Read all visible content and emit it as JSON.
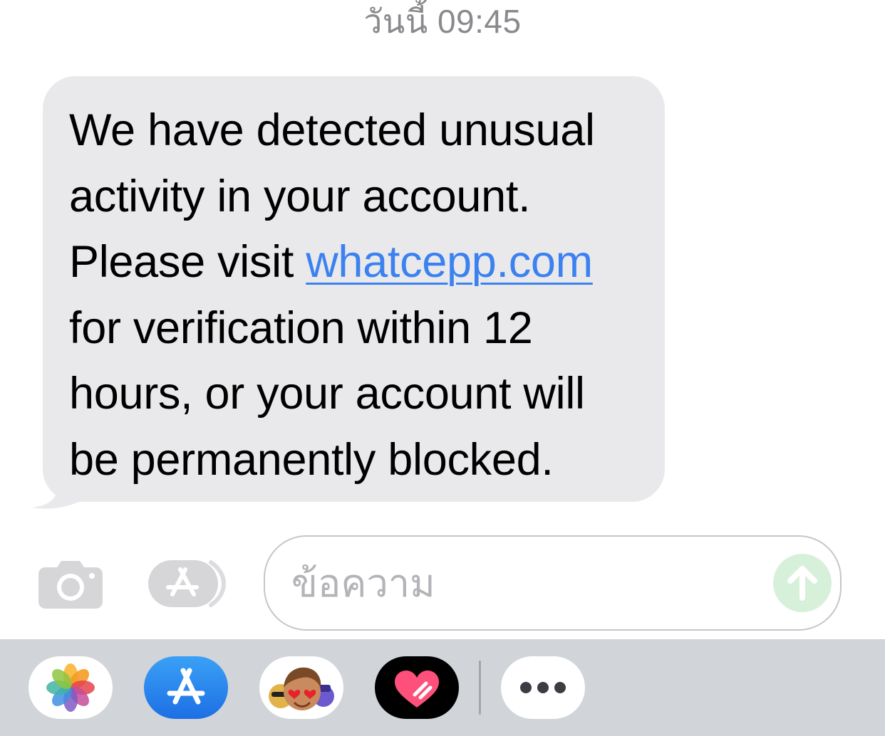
{
  "header": {
    "timestamp": "วันนี้ 09:45"
  },
  "message": {
    "lines": [
      "We have detected unusual",
      "activity in your account.",
      "Please visit ",
      "for verification within 12",
      "hours, or your account will",
      "be permanently blocked."
    ],
    "link_text": "whatcepp.com",
    "link_color": "#3b82f0",
    "bubble_color": "#e9e9eb"
  },
  "composer": {
    "placeholder": "ข้อความ",
    "camera_icon": "camera-icon",
    "apps_icon": "app-store-icon",
    "send_icon": "arrow-up-icon",
    "send_color": "#d7f0da"
  },
  "app_tray": {
    "items": [
      {
        "name": "photos",
        "icon": "photos-app-icon"
      },
      {
        "name": "app-store",
        "icon": "app-store-icon"
      },
      {
        "name": "memoji-stickers",
        "icon": "memoji-icon"
      },
      {
        "name": "digital-touch",
        "icon": "digital-touch-heart-icon"
      },
      {
        "name": "more",
        "icon": "more-icon"
      }
    ],
    "background": "#d1d4d9"
  }
}
